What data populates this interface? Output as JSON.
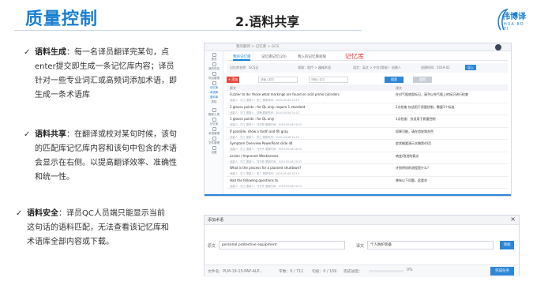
{
  "slide": {
    "title": "质量控制",
    "section": "2.语料共享",
    "logo_text": "伟博译",
    "logo_sub": "HUA BO YI"
  },
  "bullets": [
    {
      "check": "✓",
      "term": "语料生成",
      "lines": [
        "：每一名译员翻译完某句，点",
        "enter提交即生成一条记忆库内容；译员",
        "针对一些专业词汇或高频词添加术语，即",
        "生成一条术语库"
      ]
    },
    {
      "check": "✓",
      "term": "语料共享",
      "lines": [
        "：在翻译或校对某句时候，该句",
        "的匹配库记忆库内容和该句中包含的术语",
        "会显示在右侧。以提高翻译效率、准确性",
        "和统一性。"
      ]
    },
    {
      "check": "✓",
      "term": "语料安全",
      "lines": [
        "：译员QC人员端只能显示当前",
        "这句话的语料匹配，无法查看该记忆库和",
        "术语库全部内容或下载。"
      ]
    }
  ],
  "shot1": {
    "breadcrumb": "我的翻译 > 记忆库 > GCS",
    "annotation": "记忆库",
    "tabs": [
      "我的记忆库",
      "记忆库记忆(20)",
      "我入的记忆库权限"
    ],
    "sidebar": [
      "首页",
      "我的任务",
      "项目管理",
      "记忆库",
      "术语库",
      "语料库",
      "质检",
      "翻译工具",
      "记忆库",
      "术语管理",
      "文件管理",
      "设置"
    ],
    "filters": [
      "记忆库名称：GCS记",
      "领域：医疗 > 器械术语",
      "语言：英文 > 中文(简体) · 创建人",
      "创建时间：2019-02"
    ],
    "filter_button": "导入",
    "add_button": "+ 添加",
    "search_placeholder_1": "请输入原文",
    "search_placeholder_2": "请输入译文",
    "search_button": "搜索",
    "reset_button": "重置",
    "columns": [
      "原文",
      "译文"
    ],
    "rows": [
      {
        "src": "Fuzzier to do: those what markings are found on acid prime cylinders",
        "meta": "创建人：刘工    更新人：张三    更新时间：2019-05-06 20:13",
        "tgt": "在对气瓶底部标记，请予以充气瓶上的标识进行检查"
      },
      {
        "src": "2 gloves points : for QL only. require 1 standard",
        "meta": "创建人：刘工    更新人：刘畅    更新时间：2019-05-06 20:13",
        "tgt": "2点检查 仅适用于质量控制，需要1个标准"
      },
      {
        "src": "1 gloves points : for QL only",
        "meta": "创建人：刘工    更新人：刘亦菲    更新时间：2019-05-06 20:13",
        "tgt": "1点检查：仅适用于质量控制"
      },
      {
        "src": "If possible, show a tooth and fill gray.",
        "meta": "创建人：刘工    更新人：张三    更新时间：2019-05-06 20:13",
        "tgt": "如果可能，请在齿轮和灰色"
      },
      {
        "src": "Symptom Overview PowerPoint slide 44",
        "meta": "创建人：刘工    更新人：马卉卉    更新时间：2019-05-06 20:13",
        "tgt": "症状概要演示文稿第44页"
      },
      {
        "src": "Lesion / Improved Weaknesses",
        "meta": "创建人：刘工    更新人：刘亦菲    更新时间：2019-05-06 20:13",
        "tgt": "病变/改进的弱点"
      },
      {
        "src": "What is the process for a planned shutdown?",
        "meta": "创建人：刘工    更新人：张三    更新时间：2019-05-06 20:13",
        "tgt": "计划停机的流程是什么？"
      },
      {
        "src": "Had the following questions to",
        "meta": "创建人：刘工    更新人：马卉卉    更新时间：2019-05-06 20:13",
        "tgt": "曾有以下问题，此要求"
      }
    ]
  },
  "shot2": {
    "title": "添加术语",
    "close": "×",
    "source_label": "原文",
    "source_value": "personal protective equipment",
    "target_label": "译文",
    "target_value": "个人防护装备",
    "add_button": "添加",
    "footer": {
      "file_name": "文件名：PLM-19-15-PAP-ALP...",
      "chars": "字数：0 / 711",
      "sentences": "句段：0 / 109",
      "progress_label": "完成进度：",
      "progress_value": "0%",
      "done_button": "完成任务"
    }
  }
}
